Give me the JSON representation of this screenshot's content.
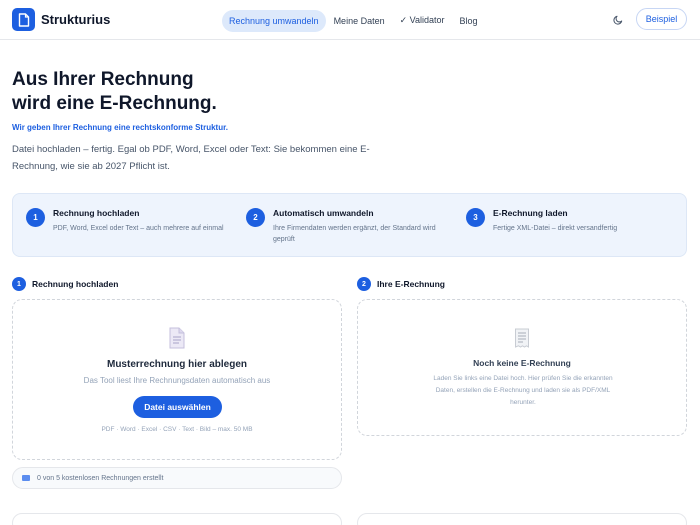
{
  "header": {
    "brand": "Strukturius",
    "nav": [
      {
        "label": "Rechnung umwandeln",
        "active": true
      },
      {
        "label": "Meine Daten",
        "active": false
      },
      {
        "label": "✓ Validator",
        "active": false
      },
      {
        "label": "Blog",
        "active": false
      }
    ],
    "example_button": "Beispiel",
    "icons": {
      "logo": "document-icon",
      "theme": "moon-icon"
    }
  },
  "hero": {
    "title_line1": "Aus Ihrer Rechnung",
    "title_line2": "wird eine E-Rechnung.",
    "tagline": "Wir geben Ihrer Rechnung eine rechtskonforme Struktur.",
    "lead": "Datei hochladen – fertig. Egal ob PDF, Word, Excel oder Text: Sie bekommen eine E-Rechnung, wie sie ab 2027 Pflicht ist."
  },
  "steps": [
    {
      "num": "1",
      "title": "Rechnung hochladen",
      "desc": "PDF, Word, Excel oder Text – auch mehrere auf einmal"
    },
    {
      "num": "2",
      "title": "Automatisch umwandeln",
      "desc": "Ihre Firmendaten werden ergänzt, der Standard wird geprüft"
    },
    {
      "num": "3",
      "title": "E-Rechnung laden",
      "desc": "Fertige XML-Datei – direkt versandfertig"
    }
  ],
  "upload": {
    "num": "1",
    "section_title": "Rechnung hochladen",
    "title": "Musterrechnung hier ablegen",
    "subtitle": "Das Tool liest Ihre Rechnungsdaten automatisch aus",
    "button": "Datei auswählen",
    "formats": "PDF · Word · Excel · CSV · Text · Bild – max. 50 MB",
    "counter": "0 von 5 kostenlosen Rechnungen erstellt"
  },
  "result": {
    "num": "2",
    "section_title": "Ihre E-Rechnung",
    "title": "Noch keine E-Rechnung",
    "text": "Laden Sie links eine Datei hoch. Hier prüfen Sie die erkannten Daten, erstellen die E-Rechnung und laden sie als PDF/XML herunter."
  },
  "colors": {
    "accent": "#1d5fe0",
    "accent_soft": "#dde9fb",
    "band": "#eef4fd"
  }
}
